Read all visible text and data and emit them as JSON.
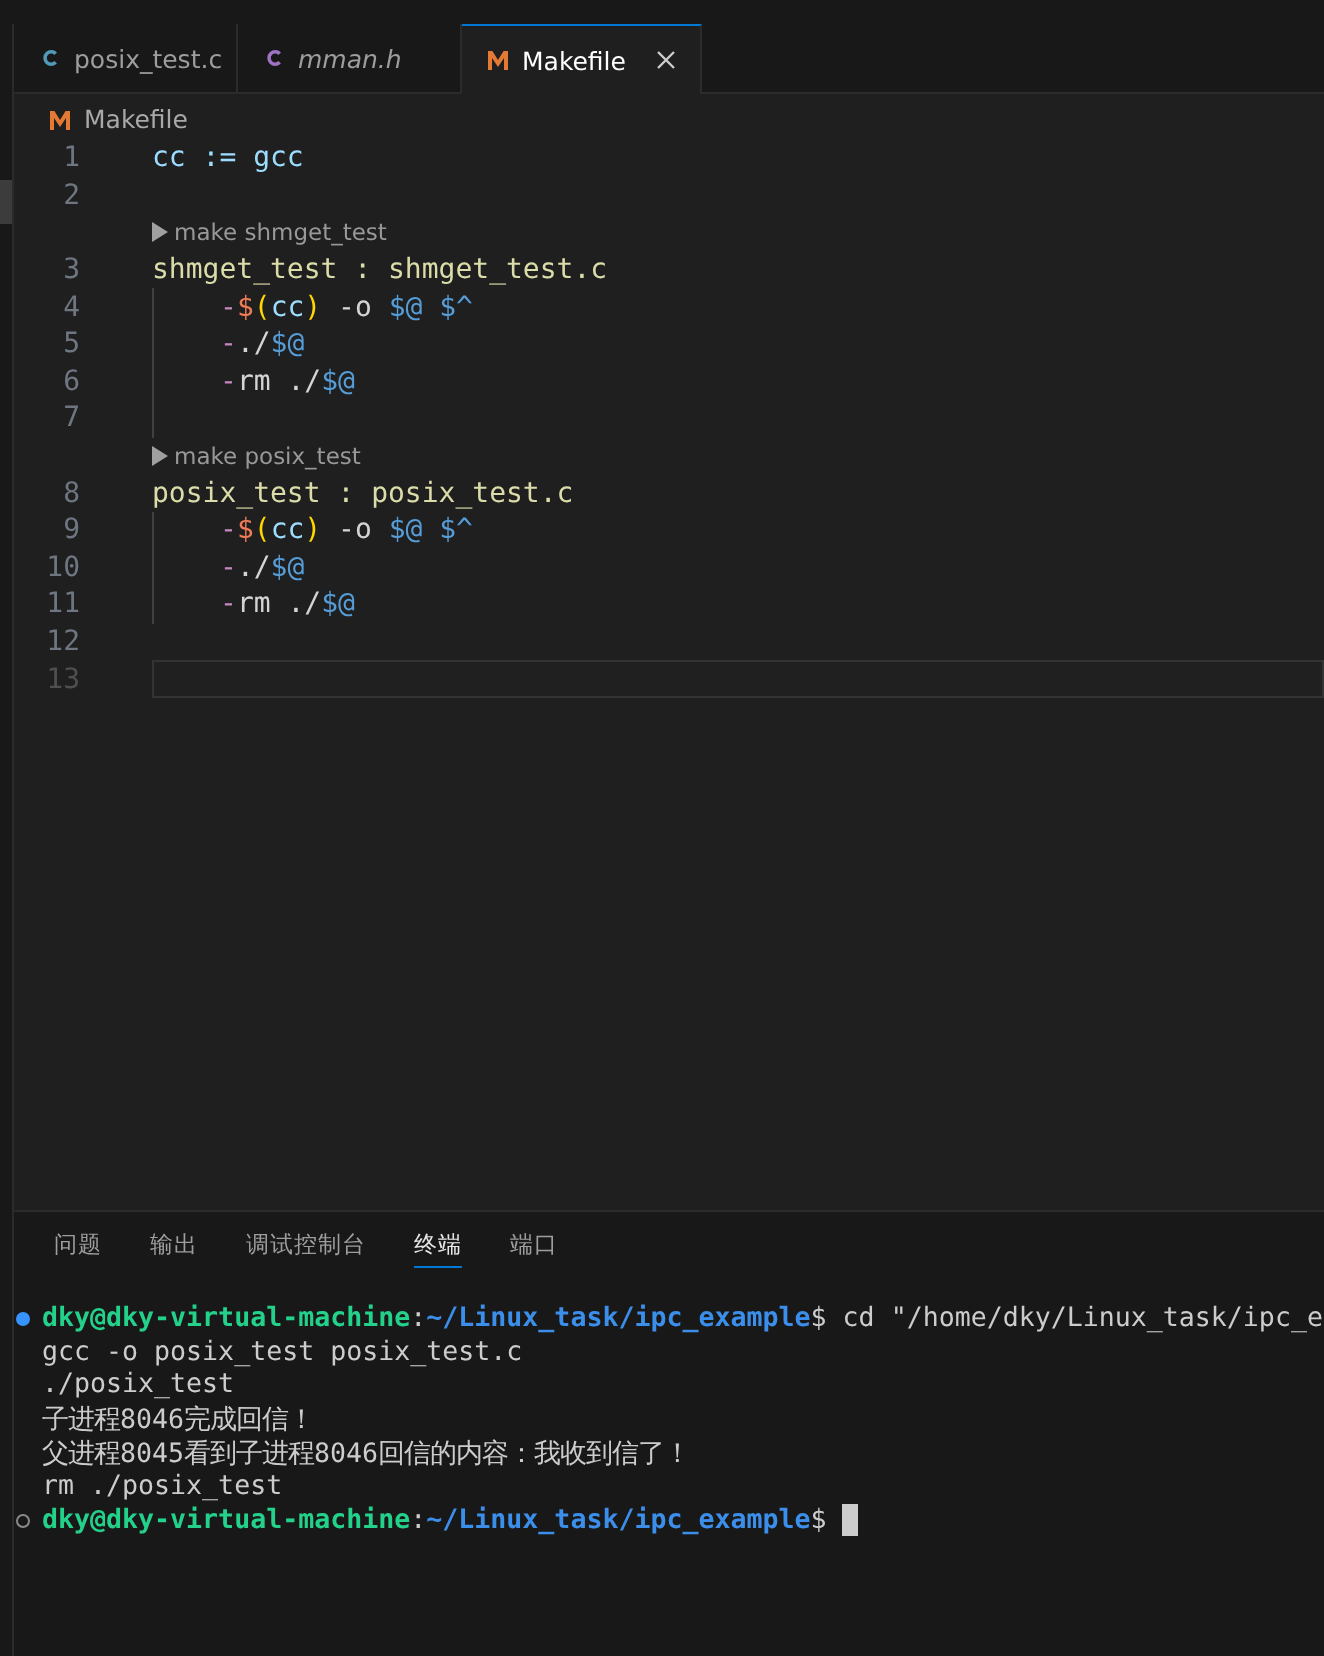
{
  "tabs": [
    {
      "label": "posix_test.c",
      "kind": "source",
      "preview": false,
      "selected": false
    },
    {
      "label": "mman.h",
      "kind": "header",
      "preview": true,
      "selected": false
    },
    {
      "label": "Makefile",
      "kind": "makefile",
      "preview": false,
      "selected": true
    }
  ],
  "breadcrumb": {
    "label": "Makefile"
  },
  "editor": {
    "lines": [
      {
        "kind": "code",
        "number": "1",
        "indent": false,
        "current": false,
        "tokens": [
          {
            "t": "cc := gcc",
            "kind": "var"
          }
        ]
      },
      {
        "kind": "code",
        "number": "2",
        "indent": false,
        "current": false
      },
      {
        "kind": "codelens",
        "text": "make shmget_test"
      },
      {
        "kind": "code",
        "number": "3",
        "indent": false,
        "current": false,
        "tokens": [
          {
            "t": "shmget_test : shmget_test.c",
            "kind": "target"
          }
        ]
      },
      {
        "kind": "code",
        "number": "4",
        "indent": true,
        "current": false,
        "tokens": [
          {
            "t": "-",
            "kind": "dash"
          },
          {
            "t": "$",
            "kind": "dollar"
          },
          {
            "t": "(",
            "kind": "paren"
          },
          {
            "t": "cc",
            "kind": "var"
          },
          {
            "t": ")",
            "kind": "paren"
          },
          {
            "t": " -o ",
            "kind": "plain"
          },
          {
            "t": "$@ $^",
            "kind": "auto"
          }
        ]
      },
      {
        "kind": "code",
        "number": "5",
        "indent": true,
        "current": false,
        "tokens": [
          {
            "t": "-",
            "kind": "dash"
          },
          {
            "t": "./",
            "kind": "plain"
          },
          {
            "t": "$@",
            "kind": "auto"
          }
        ]
      },
      {
        "kind": "code",
        "number": "6",
        "indent": true,
        "current": false,
        "tokens": [
          {
            "t": "-",
            "kind": "dash"
          },
          {
            "t": "rm ./",
            "kind": "plain"
          },
          {
            "t": "$@",
            "kind": "auto"
          }
        ]
      },
      {
        "kind": "code",
        "number": "7",
        "indent": true,
        "current": false
      },
      {
        "kind": "codelens",
        "text": "make posix_test"
      },
      {
        "kind": "code",
        "number": "8",
        "indent": false,
        "current": false,
        "tokens": [
          {
            "t": "posix_test : posix_test.c",
            "kind": "target"
          }
        ]
      },
      {
        "kind": "code",
        "number": "9",
        "indent": true,
        "current": false,
        "tokens": [
          {
            "t": "-",
            "kind": "dash"
          },
          {
            "t": "$",
            "kind": "dollar"
          },
          {
            "t": "(",
            "kind": "paren"
          },
          {
            "t": "cc",
            "kind": "var"
          },
          {
            "t": ")",
            "kind": "paren"
          },
          {
            "t": " -o ",
            "kind": "plain"
          },
          {
            "t": "$@ $^",
            "kind": "auto"
          }
        ]
      },
      {
        "kind": "code",
        "number": "10",
        "indent": true,
        "current": false,
        "tokens": [
          {
            "t": "-",
            "kind": "dash"
          },
          {
            "t": "./",
            "kind": "plain"
          },
          {
            "t": "$@",
            "kind": "auto"
          }
        ]
      },
      {
        "kind": "code",
        "number": "11",
        "indent": true,
        "current": false,
        "tokens": [
          {
            "t": "-",
            "kind": "dash"
          },
          {
            "t": "rm ./",
            "kind": "plain"
          },
          {
            "t": "$@",
            "kind": "auto"
          }
        ]
      },
      {
        "kind": "code",
        "number": "12",
        "indent": false,
        "current": false
      },
      {
        "kind": "code",
        "number": "13",
        "indent": false,
        "current": true
      }
    ]
  },
  "panel": {
    "tabs": [
      {
        "label": "问题",
        "selected": false
      },
      {
        "label": "输出",
        "selected": false
      },
      {
        "label": "调试控制台",
        "selected": false
      },
      {
        "label": "终端",
        "selected": true
      },
      {
        "label": "端口",
        "selected": false
      }
    ],
    "terminal": [
      {
        "kind": "prompt",
        "finished": true,
        "user": "dky@dky-virtual-machine",
        "sep": ":",
        "path": "~/Linux_task/ipc_example",
        "symbol": "$",
        "command": "cd \"/home/dky/Linux_task/ipc_e"
      },
      {
        "kind": "output",
        "text": "gcc -o posix_test posix_test.c"
      },
      {
        "kind": "output",
        "text": "./posix_test"
      },
      {
        "kind": "output",
        "text": "子进程8046完成回信！"
      },
      {
        "kind": "output",
        "text": "父进程8045看到子进程8046回信的内容：我收到信了！"
      },
      {
        "kind": "output",
        "text": "rm ./posix_test"
      },
      {
        "kind": "prompt",
        "finished": false,
        "user": "dky@dky-virtual-machine",
        "sep": ":",
        "path": "~/Linux_task/ipc_example",
        "symbol": "$",
        "cursor": true
      }
    ]
  }
}
